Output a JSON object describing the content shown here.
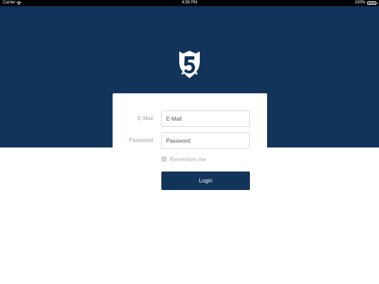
{
  "status_bar": {
    "carrier": "Carrier",
    "wifi_icon": "wifi-icon",
    "time": "4:59 PM",
    "battery_percent_text": "100%",
    "battery_level": 1.0
  },
  "colors": {
    "brand_navy": "#12345a",
    "background": "#ffffff",
    "label_gray": "#a3a3a3"
  },
  "logo": {
    "icon": "shield-5-logo-icon"
  },
  "form": {
    "email_label": "E-Mail",
    "email_placeholder": "E-Mail",
    "email_value": "",
    "password_label": "Password",
    "password_placeholder": "Password",
    "password_value": "",
    "remember_label": "Remember me",
    "remember_checked": false,
    "login_label": "Login"
  }
}
